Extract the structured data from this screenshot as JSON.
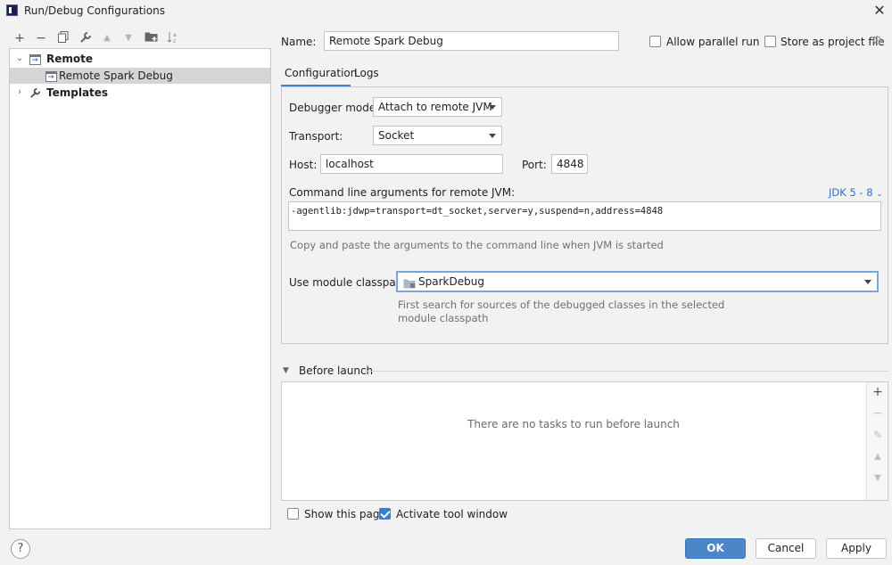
{
  "window": {
    "title": "Run/Debug Configurations"
  },
  "toolbar": {
    "add": "+",
    "remove": "−",
    "copy": "⧉",
    "edit": "🔧",
    "up": "▲",
    "down": "▼",
    "folder": "📁",
    "sort": "⇅"
  },
  "tree": {
    "group_label": "Remote",
    "child_label": "Remote Spark Debug",
    "templates_label": "Templates"
  },
  "name_row": {
    "label": "Name:",
    "value": "Remote Spark Debug",
    "allow_parallel": "Allow parallel run",
    "store_project": "Store as project file"
  },
  "tabs": [
    "Configuration",
    "Logs"
  ],
  "config": {
    "debugger_mode_label": "Debugger mode:",
    "debugger_mode_value": "Attach to remote JVM",
    "transport_label": "Transport:",
    "transport_value": "Socket",
    "host_label": "Host:",
    "host_value": "localhost",
    "port_label": "Port:",
    "port_value": "4848",
    "cmd_label": "Command line arguments for remote JVM:",
    "jdk_link": "JDK 5 - 8",
    "cmd_value": "-agentlib:jdwp=transport=dt_socket,server=y,suspend=n,address=4848",
    "cmd_hint": "Copy and paste the arguments to the command line when JVM is started",
    "module_label": "Use module classpath:",
    "module_value": "SparkDebug",
    "module_hint_1": "First search for sources of the debugged classes in the selected",
    "module_hint_2": "module classpath"
  },
  "before_launch": {
    "header": "Before launch",
    "empty_text": "There are no tasks to run before launch"
  },
  "bottom": {
    "show_page": "Show this page",
    "activate_tool": "Activate tool window",
    "help": "?",
    "ok": "OK",
    "cancel": "Cancel",
    "apply": "Apply"
  },
  "colors": {
    "accent": "#4a86c8",
    "link": "#2f70c0",
    "selection": "#d5d5d5"
  }
}
